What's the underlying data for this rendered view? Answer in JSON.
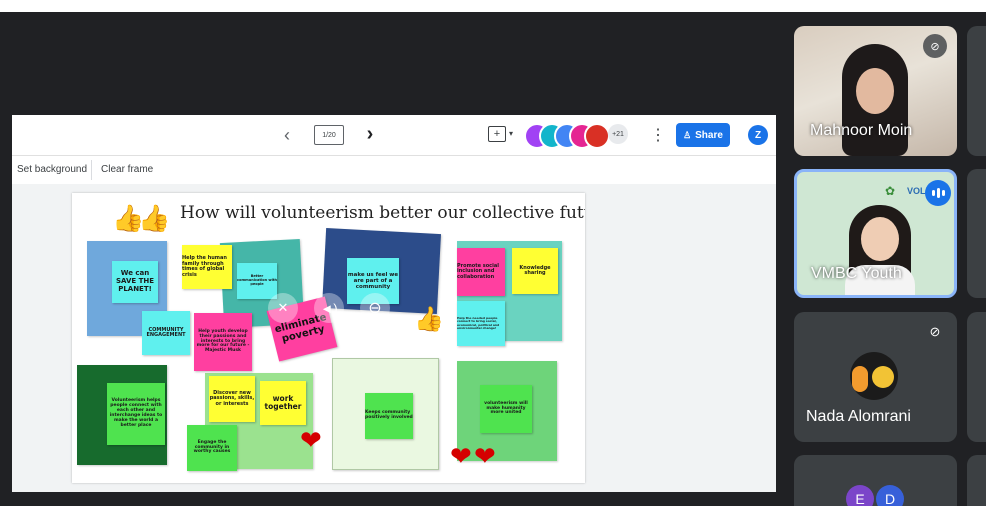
{
  "toolbar": {
    "prev_label": "‹",
    "page_indicator": "1/20",
    "next_label": "›",
    "more_count": "+21",
    "more_menu": "⋮",
    "share_label": "Share",
    "profile_initial": "Z"
  },
  "frame_bar": {
    "set_background": "Set background",
    "clear_frame": "Clear frame"
  },
  "board": {
    "title": "How will volunteerism better our collective future?",
    "notes": [
      "We can SAVE THE PLANET!",
      "Help the human family through times of global crisis",
      "Better communication with people",
      "make us feel we are part of a community",
      "Promote social inclusion and collaboration",
      "Knowledge sharing",
      "Help the needed people connect to bring social, economical, political and environmental change!",
      "COMMUNITY ENGAGEMENT",
      "Help youth develop their passions and interests to bring more for our future - Majestic Musk",
      "eliminate poverty",
      "Volunteerism helps people connect with each other and interchange ideas to make the world a better place",
      "Discover new passions, skills, or interests",
      "work together",
      "Engage the community in worthy causes",
      "Keeps community positively involved",
      "volunteerism will make humanity more united"
    ]
  },
  "participants": [
    {
      "name": "Mahnoor Moin",
      "muted": true
    },
    {
      "name": "VMBC Youth",
      "speaking": true,
      "logo_text": "VOLU"
    },
    {
      "name": "Nada Alomrani",
      "muted": true
    },
    {
      "initials": [
        "E",
        "D"
      ]
    }
  ],
  "colors": {
    "share_blue": "#1a73e8",
    "speaking_border": "#8ab4f8",
    "sticky_yellow": "#ffff33",
    "sticky_cyan": "#5ff0ee",
    "sticky_pink": "#ff3fa0",
    "sticky_green": "#4fe34f",
    "avatar_e": "#7b45c9",
    "avatar_d": "#3760d9"
  }
}
